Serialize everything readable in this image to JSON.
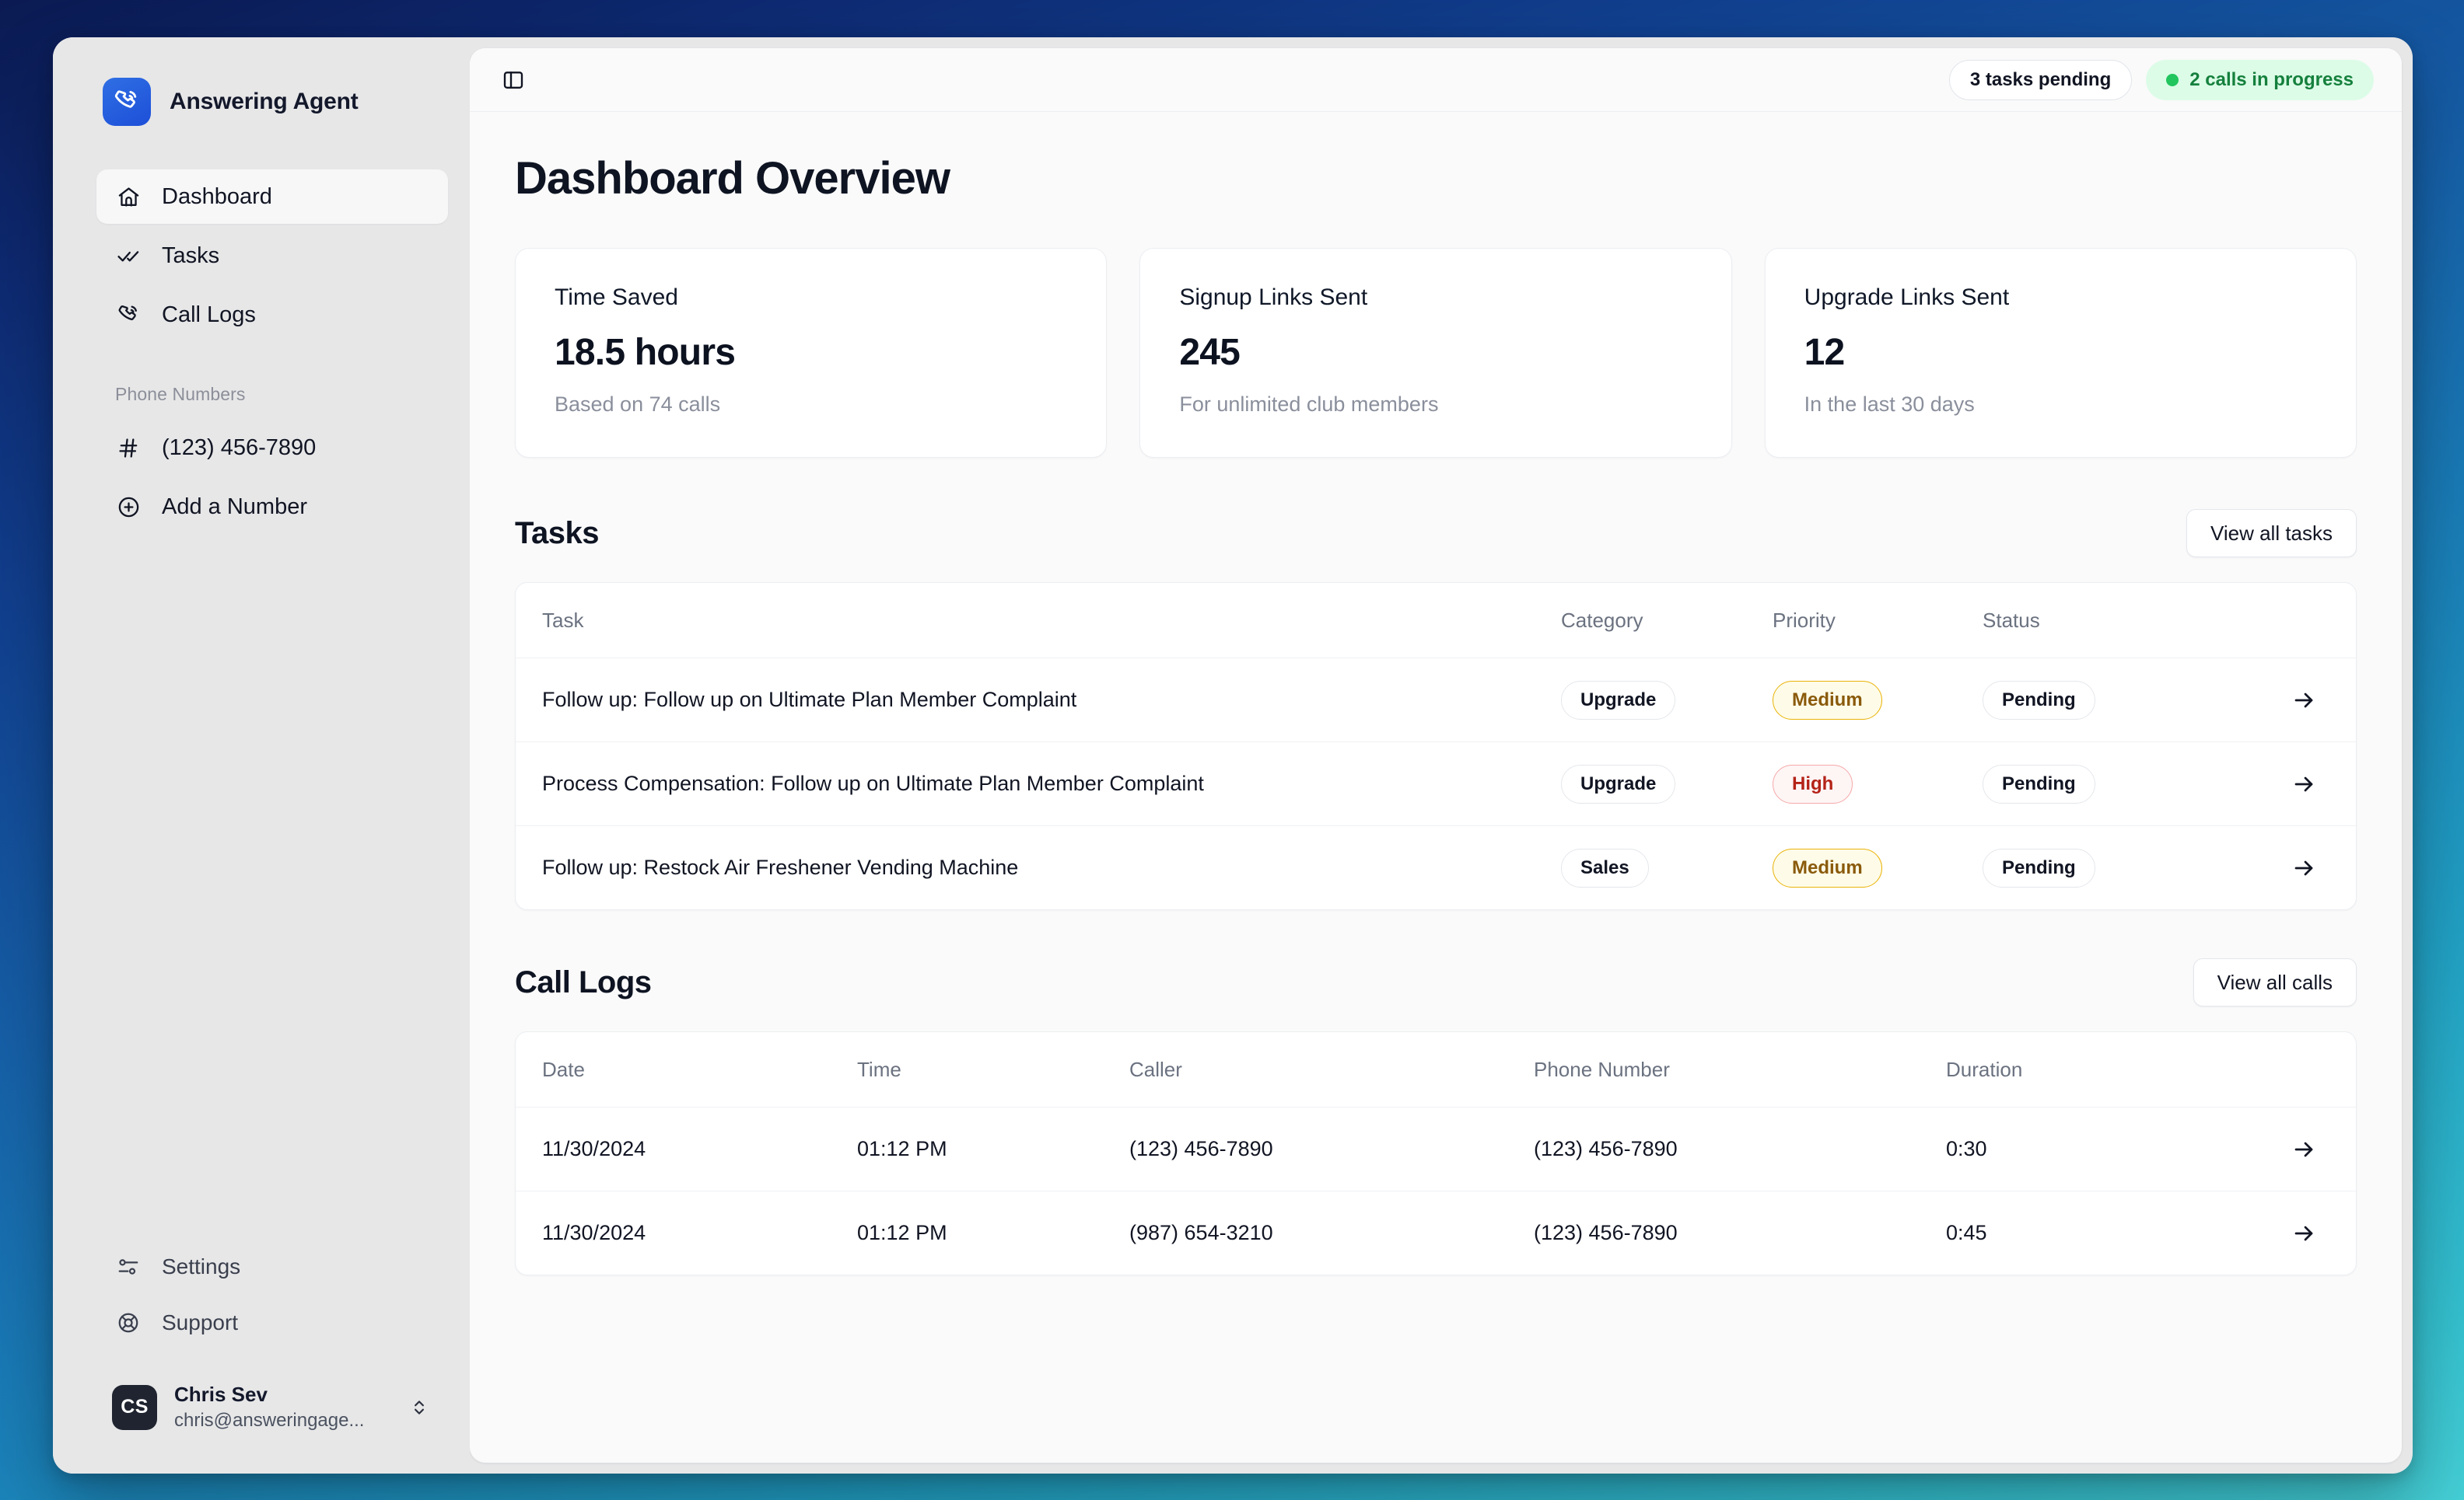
{
  "brand": {
    "name": "Answering Agent",
    "logo_icon": "phone-call-icon",
    "logo_color": "#1d4fd8"
  },
  "sidebar": {
    "nav": [
      {
        "label": "Dashboard",
        "icon": "home-icon",
        "active": true
      },
      {
        "label": "Tasks",
        "icon": "double-check-icon",
        "active": false
      },
      {
        "label": "Call Logs",
        "icon": "phone-call-icon",
        "active": false
      }
    ],
    "section_label": "Phone Numbers",
    "phone_numbers": [
      {
        "label": "(123) 456-7890",
        "icon": "hash-icon"
      },
      {
        "label": "Add a Number",
        "icon": "plus-circle-icon"
      }
    ],
    "footer": [
      {
        "label": "Settings",
        "icon": "sliders-icon"
      },
      {
        "label": "Support",
        "icon": "lifebuoy-icon"
      }
    ],
    "user": {
      "initials": "CS",
      "name": "Chris Sev",
      "email": "chris@answeringage...",
      "chevrons_icon": "chevrons-up-down-icon"
    }
  },
  "topbar": {
    "toggle_icon": "sidebar-panel-icon",
    "tasks_badge": "3 tasks pending",
    "calls_badge": "2 calls in progress",
    "calls_badge_dot_color": "#22c55e",
    "calls_badge_bg": "#dcfce7",
    "calls_badge_text_color": "#15803d"
  },
  "page": {
    "title": "Dashboard Overview"
  },
  "stats": [
    {
      "label": "Time Saved",
      "value": "18.5 hours",
      "sub": "Based on 74 calls"
    },
    {
      "label": "Signup Links Sent",
      "value": "245",
      "sub": "For unlimited club members"
    },
    {
      "label": "Upgrade Links Sent",
      "value": "12",
      "sub": "In the last 30 days"
    }
  ],
  "tasks_section": {
    "title": "Tasks",
    "view_all_label": "View all tasks",
    "columns": [
      "Task",
      "Category",
      "Priority",
      "Status"
    ],
    "rows": [
      {
        "task": "Follow up: Follow up on Ultimate Plan Member Complaint",
        "category": "Upgrade",
        "priority": "Medium",
        "priority_level": "medium",
        "status": "Pending",
        "arrow_icon": "arrow-right-icon"
      },
      {
        "task": "Process Compensation: Follow up on Ultimate Plan Member Complaint",
        "category": "Upgrade",
        "priority": "High",
        "priority_level": "high",
        "status": "Pending",
        "arrow_icon": "arrow-right-icon"
      },
      {
        "task": "Follow up: Restock Air Freshener Vending Machine",
        "category": "Sales",
        "priority": "Medium",
        "priority_level": "medium",
        "status": "Pending",
        "arrow_icon": "arrow-right-icon"
      }
    ]
  },
  "calls_section": {
    "title": "Call Logs",
    "view_all_label": "View all calls",
    "columns": [
      "Date",
      "Time",
      "Caller",
      "Phone Number",
      "Duration"
    ],
    "rows": [
      {
        "date": "11/30/2024",
        "time": "01:12 PM",
        "caller": "(123) 456-7890",
        "phone": "(123) 456-7890",
        "duration": "0:30",
        "arrow_icon": "arrow-right-icon"
      },
      {
        "date": "11/30/2024",
        "time": "01:12 PM",
        "caller": "(987) 654-3210",
        "phone": "(123) 456-7890",
        "duration": "0:45",
        "arrow_icon": "arrow-right-icon"
      }
    ]
  }
}
